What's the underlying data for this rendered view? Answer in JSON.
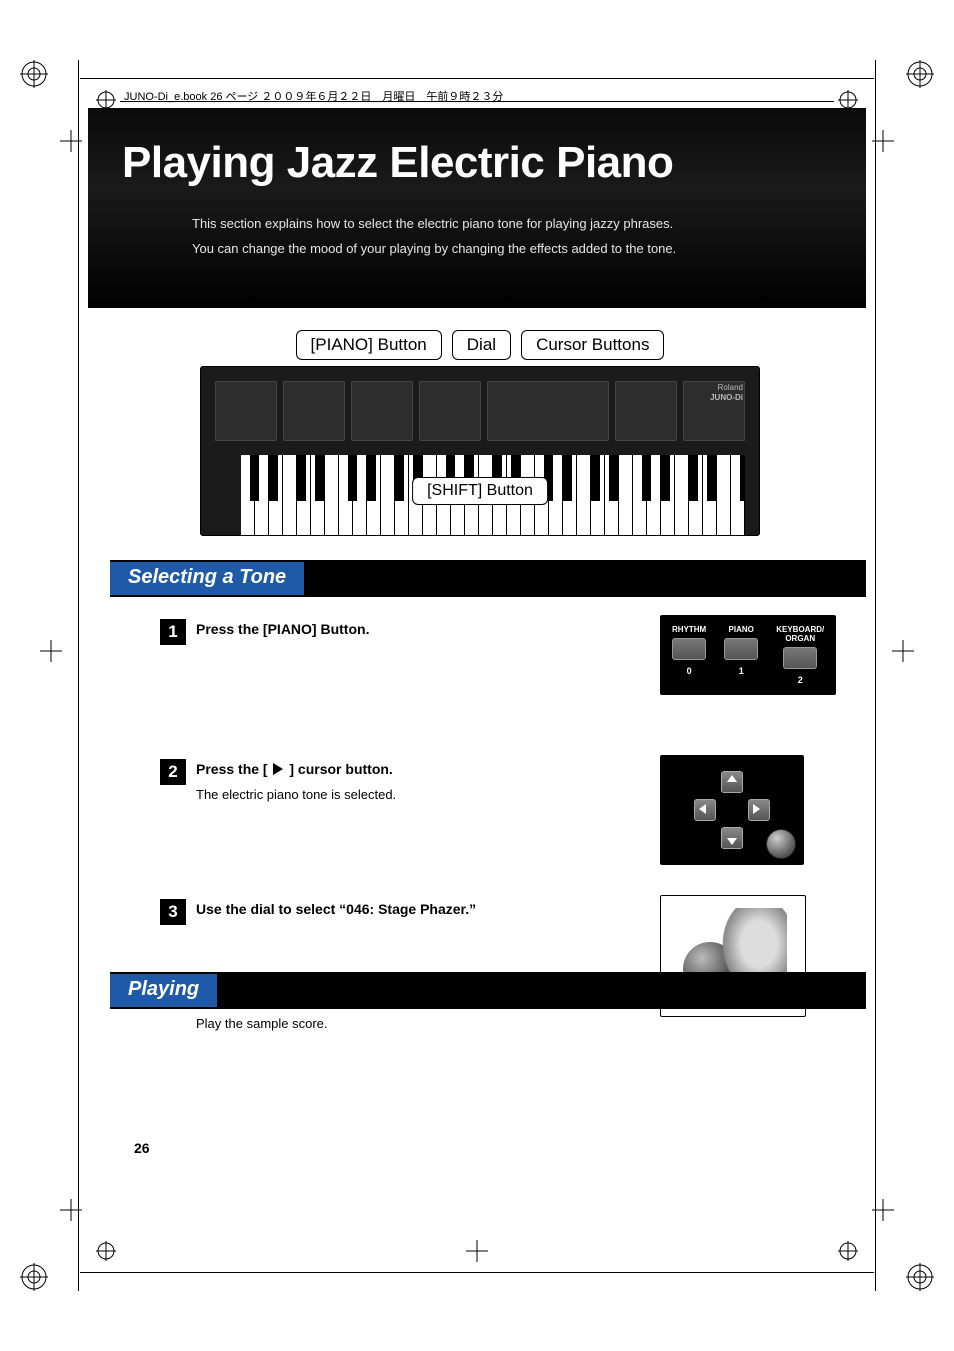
{
  "header_text": "JUNO-Di_e.book  26 ページ  ２００９年６月２２日　月曜日　午前９時２３分",
  "page_number": "26",
  "hero": {
    "title": "Playing Jazz Electric Piano",
    "p1": "This section explains how to select the electric piano tone for playing jazzy phrases.",
    "p2": "You can change the mood of your playing by changing the effects added to the tone."
  },
  "callouts": {
    "piano_btn": "[PIANO] Button",
    "dial": "Dial",
    "cursor": "Cursor Buttons",
    "shift": "[SHIFT] Button"
  },
  "brand": {
    "l1": "Roland",
    "l2": "JUNO-Di"
  },
  "sections": {
    "selecting": {
      "title": "Selecting a Tone",
      "bar_color": "#2860b0"
    },
    "playing": {
      "title": "Playing",
      "body": "Play the sample score."
    }
  },
  "steps": {
    "s1": {
      "num": "1",
      "title": "Press the [PIANO] Button.",
      "panel_labels": {
        "a": "RHYTHM",
        "b": "PIANO",
        "c": "KEYBOARD/\nORGAN",
        "n0": "0",
        "n1": "1",
        "n2": "2"
      }
    },
    "s2": {
      "num": "2",
      "title_pre": "Press the [ ",
      "title_post": " ] cursor button.",
      "text": "The electric piano tone is selected."
    },
    "s3": {
      "num": "3",
      "title": "Use the dial to select “046: Stage Phazer.”"
    }
  }
}
